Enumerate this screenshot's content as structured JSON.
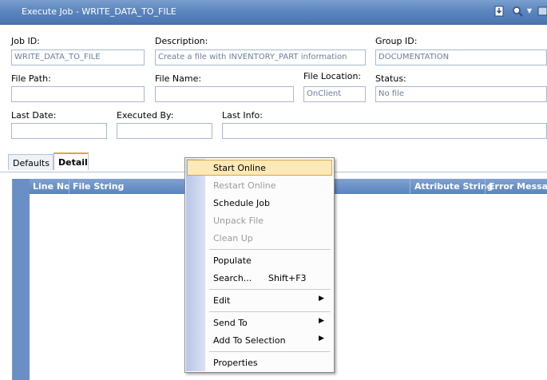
{
  "window": {
    "title": "Execute Job - WRITE_DATA_TO_FILE"
  },
  "toolbar": {
    "save_icon": "save-icon",
    "search_icon": "search-icon",
    "dropdown_icon": "dropdown-icon"
  },
  "form": {
    "job_id": {
      "label": "Job ID:",
      "value": "WRITE_DATA_TO_FILE"
    },
    "description": {
      "label": "Description:",
      "value": "Create a file with INVENTORY_PART information"
    },
    "group_id": {
      "label": "Group ID:",
      "value": "DOCUMENTATION"
    },
    "file_path": {
      "label": "File Path:",
      "value": ""
    },
    "file_name": {
      "label": "File Name:",
      "value": ""
    },
    "file_location": {
      "label": "File Location:",
      "value": "OnClient"
    },
    "status": {
      "label": "Status:",
      "value": "No file"
    },
    "last_date": {
      "label": "Last Date:",
      "value": ""
    },
    "executed_by": {
      "label": "Executed By:",
      "value": ""
    },
    "last_info": {
      "label": "Last Info:",
      "value": ""
    }
  },
  "tabs": [
    {
      "label": "Defaults",
      "active": false
    },
    {
      "label": "Detail",
      "active": true
    }
  ],
  "grid": {
    "columns": [
      "Line No",
      "File String",
      "Attribute String",
      "Error Message"
    ]
  },
  "context_menu": {
    "items": [
      {
        "label": "Start Online",
        "state": "hover"
      },
      {
        "label": "Restart Online",
        "state": "disabled"
      },
      {
        "label": "Schedule Job",
        "state": "enabled"
      },
      {
        "label": "Unpack File",
        "state": "disabled"
      },
      {
        "label": "Clean Up",
        "state": "disabled"
      },
      {
        "label": "Populate",
        "state": "enabled"
      },
      {
        "label": "Search...",
        "shortcut": "Shift+F3",
        "state": "enabled"
      },
      {
        "label": "Edit",
        "submenu": true,
        "state": "enabled"
      },
      {
        "label": "Send To",
        "submenu": true,
        "state": "enabled"
      },
      {
        "label": "Add To Selection",
        "submenu": true,
        "state": "enabled"
      },
      {
        "label": "Properties",
        "state": "enabled"
      }
    ]
  }
}
